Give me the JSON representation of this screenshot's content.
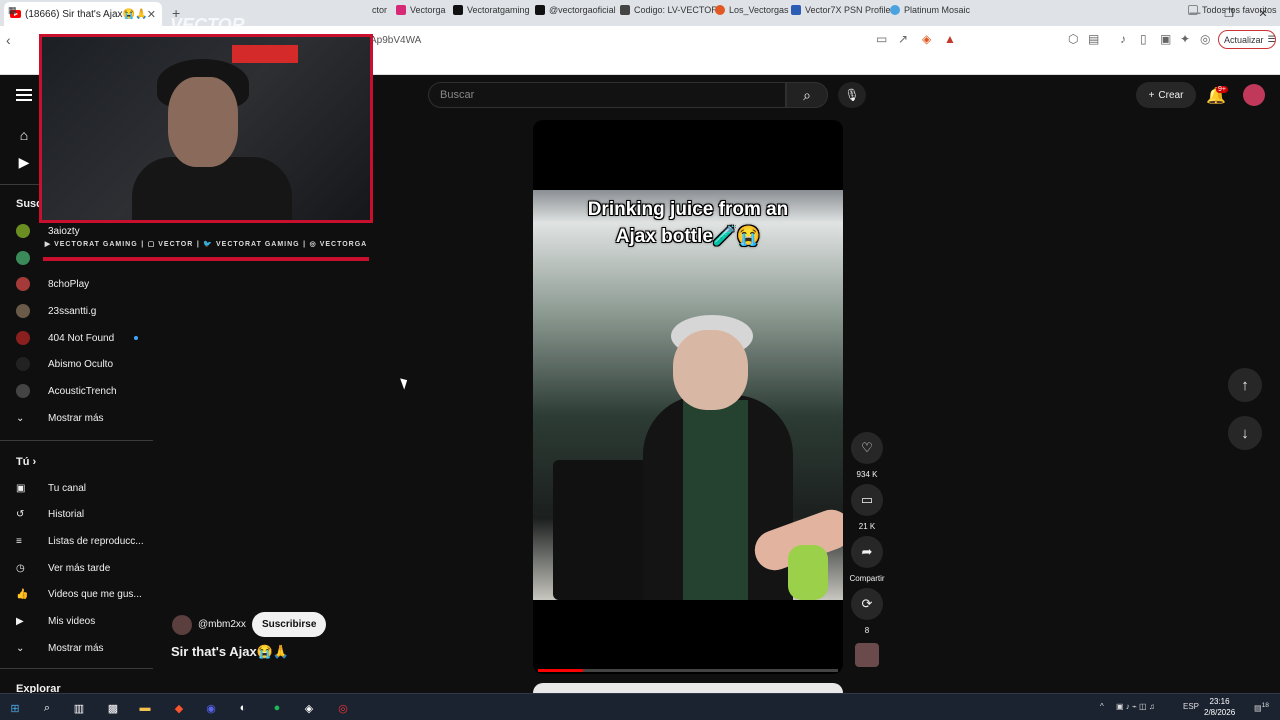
{
  "browser": {
    "tab_title": "(18666) Sir that's Ajax😭🙏",
    "url_fragment": "Ap9bV4WA",
    "update_label": "Actualizar",
    "bookmarks": [
      "ctor",
      "Vectorga",
      "Vectoratgaming",
      "@vectorgaoficial",
      "Codigo: LV-VECTOR",
      "Los_Vectorgas",
      "Vector7X PSN Profile",
      "Platinum Mosaic"
    ],
    "all_favorites": "Todos los favoritos"
  },
  "overlay": {
    "socials": [
      "VECTORAT GAMING",
      "VECTOR",
      "VECTORAT GAMING",
      "VECTORGA"
    ],
    "cam_sign": "",
    "logo_text": "VECTOR"
  },
  "sidebar": {
    "subs_title": "Susc",
    "subs": [
      "3aiozty",
      "",
      "8choPlay",
      "23ssantti.g",
      "404 Not Found",
      "Abismo Oculto",
      "AcousticTrench"
    ],
    "show_more": "Mostrar más",
    "you_title": "Tú",
    "you_items": [
      "Tu canal",
      "Historial",
      "Listas de reproducc...",
      "Ver más tarde",
      "Videos que me gus...",
      "Mis videos",
      "Mostrar más"
    ],
    "explore_title": "Explorar"
  },
  "topbar": {
    "search_placeholder": "Buscar",
    "create_label": "Crear",
    "notif_badge": "9+"
  },
  "short": {
    "caption_line1": "Drinking juice from an",
    "caption_line2": "Ajax bottle🧪😭",
    "likes": "934 K",
    "comments": "21 K",
    "share": "Compartir",
    "remix": "8",
    "owner": "@mbm2xx",
    "subscribe": "Suscribirse",
    "title": "Sir that's Ajax😭🙏",
    "progress": 0.15
  },
  "taskbar": {
    "lang": "ESP",
    "time": "23:16",
    "date": "2/8/2026",
    "notif": "18"
  }
}
